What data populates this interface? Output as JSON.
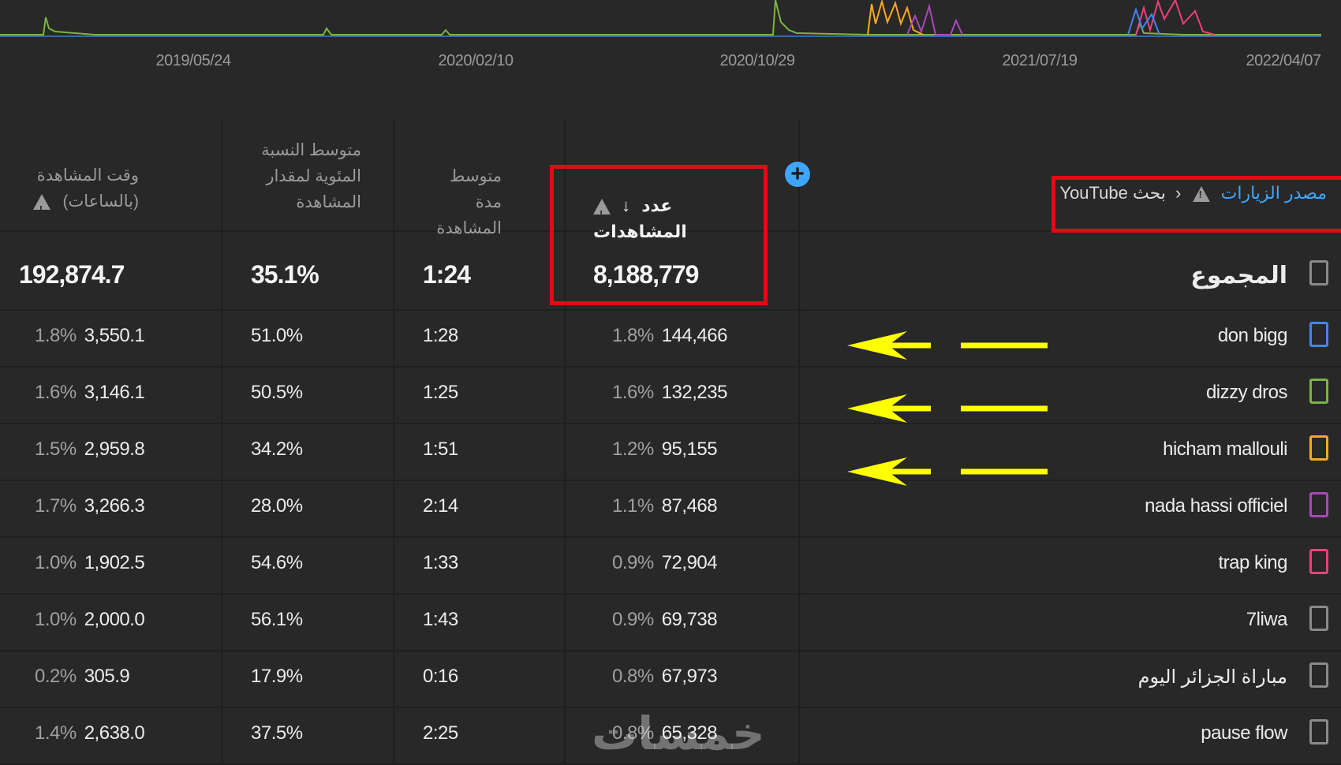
{
  "chart": {
    "x_ticks": [
      "2019/05/24",
      "2020/02/10",
      "2020/10/29",
      "2021/07/19",
      "2022/04/07"
    ]
  },
  "headers": {
    "watch_time": "وقت المشاهدة (بالساعات)",
    "avg_pct": "متوسط النسبة المئوية لمقدار المشاهدة",
    "avg_duration": "متوسط مدة المشاهدة",
    "views": "عدد المشاهدات",
    "source_label": "مصدر الزيارات",
    "source_crumb": "بحث YouTube"
  },
  "total": {
    "label": "المجموع",
    "watch_time": "192,874.7",
    "avg_pct": "35.1%",
    "avg_duration": "1:24",
    "views": "8,188,779"
  },
  "rows": [
    {
      "name": "don bigg",
      "color": "#4285f4",
      "views": "144,466",
      "views_pct": "1.8%",
      "duration": "1:28",
      "avg_pct": "51.0%",
      "watch": "3,550.1",
      "watch_pct": "1.8%"
    },
    {
      "name": "dizzy dros",
      "color": "#7cb342",
      "views": "132,235",
      "views_pct": "1.6%",
      "duration": "1:25",
      "avg_pct": "50.5%",
      "watch": "3,146.1",
      "watch_pct": "1.6%"
    },
    {
      "name": "hicham mallouli",
      "color": "#f9a825",
      "views": "95,155",
      "views_pct": "1.2%",
      "duration": "1:51",
      "avg_pct": "34.2%",
      "watch": "2,959.8",
      "watch_pct": "1.5%"
    },
    {
      "name": "nada hassi officiel",
      "color": "#ab47bc",
      "views": "87,468",
      "views_pct": "1.1%",
      "duration": "2:14",
      "avg_pct": "28.0%",
      "watch": "3,266.3",
      "watch_pct": "1.7%"
    },
    {
      "name": "trap king",
      "color": "#ec407a",
      "views": "72,904",
      "views_pct": "0.9%",
      "duration": "1:33",
      "avg_pct": "54.6%",
      "watch": "1,902.5",
      "watch_pct": "1.0%"
    },
    {
      "name": "7liwa",
      "color": "#8a8a8a",
      "views": "69,738",
      "views_pct": "0.9%",
      "duration": "1:43",
      "avg_pct": "56.1%",
      "watch": "2,000.0",
      "watch_pct": "1.0%"
    },
    {
      "name": "مباراة الجزائر اليوم",
      "color": "#8a8a8a",
      "views": "67,973",
      "views_pct": "0.8%",
      "duration": "0:16",
      "avg_pct": "17.9%",
      "watch": "305.9",
      "watch_pct": "0.2%"
    },
    {
      "name": "pause flow",
      "color": "#8a8a8a",
      "views": "65,328",
      "views_pct": "0.8%",
      "duration": "2:25",
      "avg_pct": "37.5%",
      "watch": "2,638.0",
      "watch_pct": "1.4%"
    }
  ],
  "watermark": "خمسات",
  "colors": {
    "accent": "#3ea6ff",
    "highlight": "#e50914",
    "arrow": "#ffff00"
  }
}
